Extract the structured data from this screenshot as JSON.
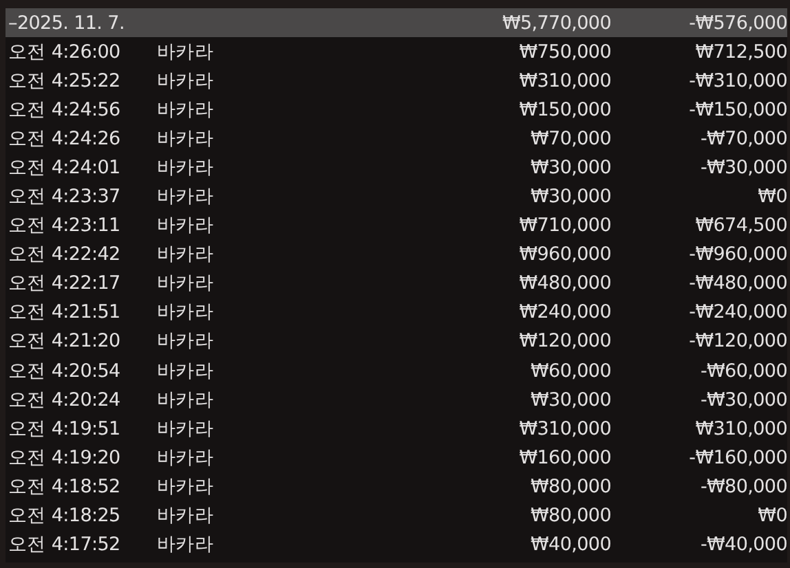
{
  "summary": {
    "date": "–2025. 11. 7.",
    "bet": "₩5,770,000",
    "result": "-₩576,000"
  },
  "rows": [
    {
      "time": "오전 4:26:00",
      "game": "바카라",
      "bet": "₩750,000",
      "result": "₩712,500"
    },
    {
      "time": "오전 4:25:22",
      "game": "바카라",
      "bet": "₩310,000",
      "result": "-₩310,000"
    },
    {
      "time": "오전 4:24:56",
      "game": "바카라",
      "bet": "₩150,000",
      "result": "-₩150,000"
    },
    {
      "time": "오전 4:24:26",
      "game": "바카라",
      "bet": "₩70,000",
      "result": "-₩70,000"
    },
    {
      "time": "오전 4:24:01",
      "game": "바카라",
      "bet": "₩30,000",
      "result": "-₩30,000"
    },
    {
      "time": "오전 4:23:37",
      "game": "바카라",
      "bet": "₩30,000",
      "result": "₩0"
    },
    {
      "time": "오전 4:23:11",
      "game": "바카라",
      "bet": "₩710,000",
      "result": "₩674,500"
    },
    {
      "time": "오전 4:22:42",
      "game": "바카라",
      "bet": "₩960,000",
      "result": "-₩960,000"
    },
    {
      "time": "오전 4:22:17",
      "game": "바카라",
      "bet": "₩480,000",
      "result": "-₩480,000"
    },
    {
      "time": "오전 4:21:51",
      "game": "바카라",
      "bet": "₩240,000",
      "result": "-₩240,000"
    },
    {
      "time": "오전 4:21:20",
      "game": "바카라",
      "bet": "₩120,000",
      "result": "-₩120,000"
    },
    {
      "time": "오전 4:20:54",
      "game": "바카라",
      "bet": "₩60,000",
      "result": "-₩60,000"
    },
    {
      "time": "오전 4:20:24",
      "game": "바카라",
      "bet": "₩30,000",
      "result": "-₩30,000"
    },
    {
      "time": "오전 4:19:51",
      "game": "바카라",
      "bet": "₩310,000",
      "result": "₩310,000"
    },
    {
      "time": "오전 4:19:20",
      "game": "바카라",
      "bet": "₩160,000",
      "result": "-₩160,000"
    },
    {
      "time": "오전 4:18:52",
      "game": "바카라",
      "bet": "₩80,000",
      "result": "-₩80,000"
    },
    {
      "time": "오전 4:18:25",
      "game": "바카라",
      "bet": "₩80,000",
      "result": "₩0"
    },
    {
      "time": "오전 4:17:52",
      "game": "바카라",
      "bet": "₩40,000",
      "result": "-₩40,000"
    }
  ]
}
